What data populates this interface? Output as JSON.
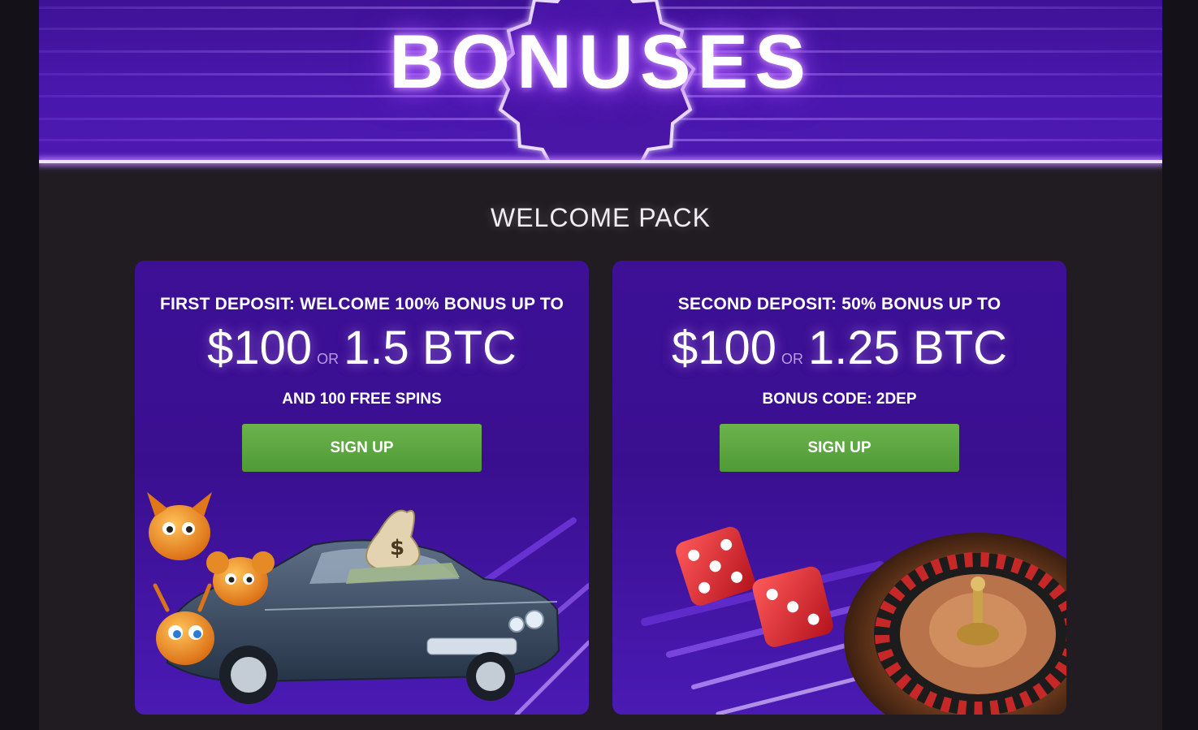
{
  "banner": {
    "title": "BONUSES"
  },
  "section": {
    "title": "WELCOME PACK"
  },
  "cards": [
    {
      "headline": "FIRST DEPOSIT: WELCOME 100% BONUS UP TO",
      "amount_usd": "$100",
      "or_label": "OR",
      "amount_btc": "1.5 BTC",
      "subline": "AND 100 FREE SPINS",
      "button_label": "SIGN UP",
      "money_symbol": "$"
    },
    {
      "headline": "SECOND DEPOSIT: 50% BONUS UP TO",
      "amount_usd": "$100",
      "or_label": "OR",
      "amount_btc": "1.25 BTC",
      "subline": "BONUS CODE: 2DEP",
      "button_label": "SIGN UP"
    }
  ],
  "colors": {
    "page_bg": "#201c22",
    "banner": "#4a17ad",
    "card": "#3d1096",
    "button": "#5ea640",
    "neon": "#e9d8ff"
  }
}
